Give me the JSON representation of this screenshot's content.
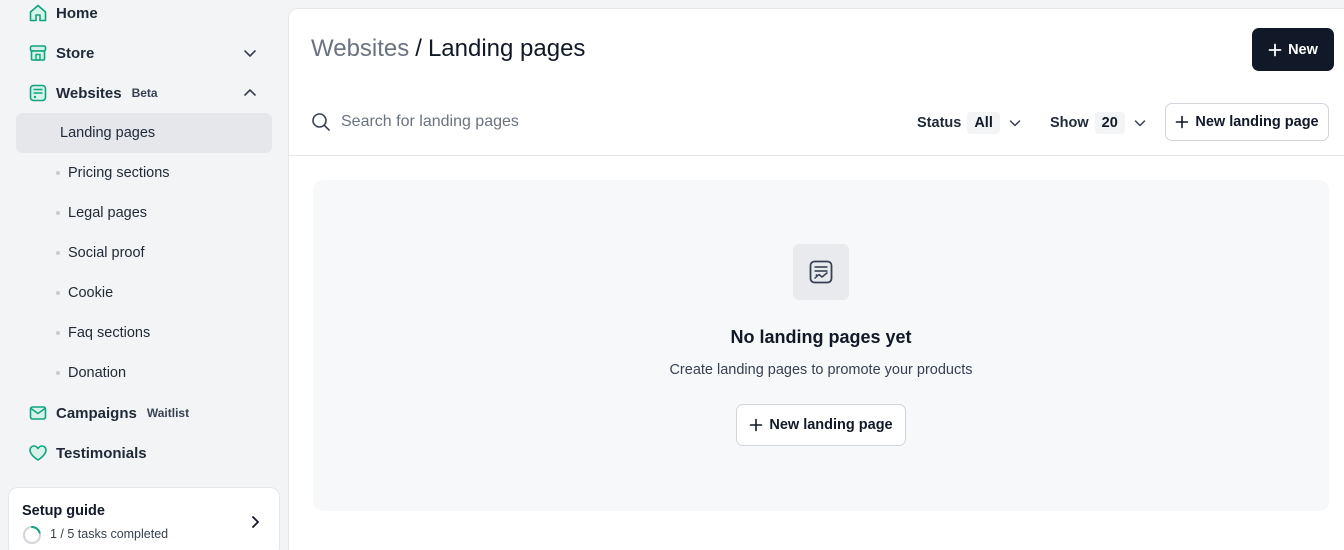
{
  "sidebar": {
    "home": "Home",
    "store": "Store",
    "websites": "Websites",
    "websites_badge": "Beta",
    "sub_items": [
      "Landing pages",
      "Pricing sections",
      "Legal pages",
      "Social proof",
      "Cookie",
      "Faq sections",
      "Donation"
    ],
    "campaigns": "Campaigns",
    "campaigns_badge": "Waitlist",
    "testimonials": "Testimonials",
    "setup": {
      "title": "Setup guide",
      "progress": "1 / 5 tasks completed",
      "completed_fraction": 0.2
    }
  },
  "header": {
    "crumb_parent": "Websites",
    "crumb_sep": "/",
    "crumb_current": "Landing pages",
    "new_button": "New"
  },
  "toolbar": {
    "search_placeholder": "Search for landing pages",
    "status_label": "Status",
    "status_value": "All",
    "show_label": "Show",
    "show_value": "20",
    "new_landing_button": "New landing page"
  },
  "empty_state": {
    "title": "No landing pages yet",
    "description": "Create landing pages to promote your products",
    "button": "New landing page"
  },
  "colors": {
    "accent": "#10a37f",
    "dark": "#111827",
    "muted": "#6b7280"
  }
}
